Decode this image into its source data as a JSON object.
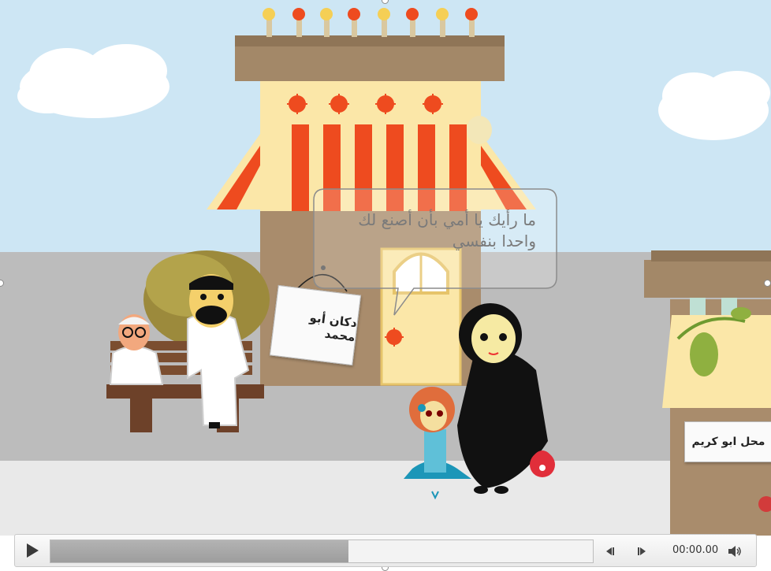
{
  "scene": {
    "speech_bubble": {
      "line1": "ما رأيك يا أمي بأن أصنع لك",
      "line2": "واحدا بنفسي"
    },
    "shop_sign_main": "دكان أبو محمد",
    "shop_sign_right": "محل ابو كريم"
  },
  "player": {
    "time": "00:00.00",
    "progress_fraction": 0.55
  },
  "colors": {
    "sky": "#cde6f4",
    "street": "#bcbcbc",
    "sidewalk": "#e9e9e9",
    "awning_red": "#ee4b1f",
    "awning_cream": "#fbe7a8",
    "building": "#a98c6c",
    "roof": "#a38868"
  },
  "icons": [
    "play-icon",
    "skip-back-icon",
    "skip-forward-icon",
    "volume-icon"
  ]
}
